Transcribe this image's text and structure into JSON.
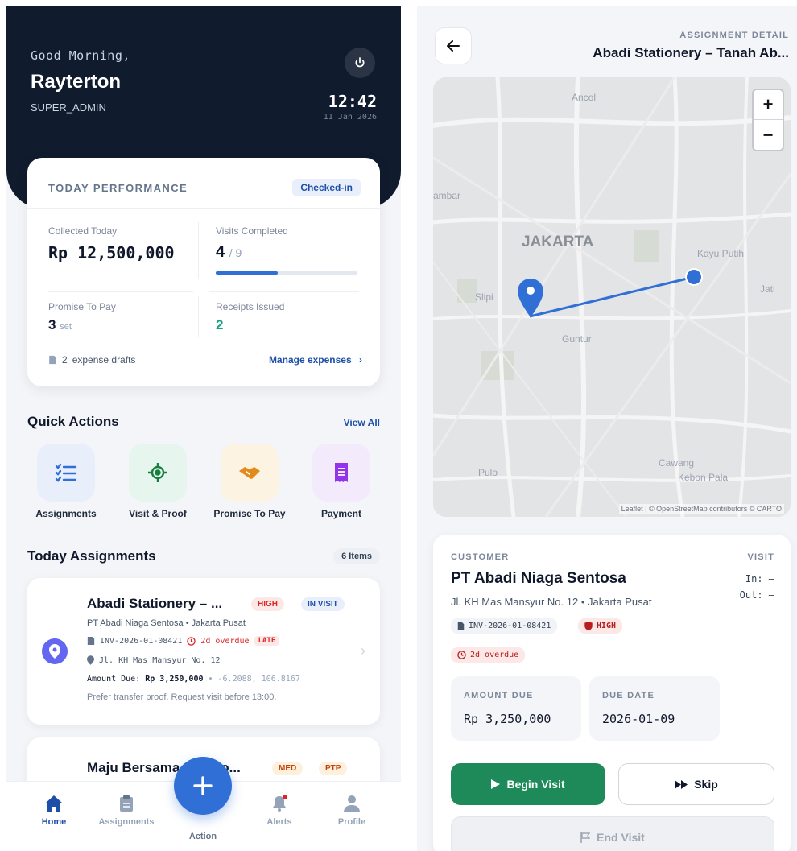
{
  "home": {
    "greeting": "Good Morning,",
    "user_name": "Rayterton",
    "role": "SUPER_ADMIN",
    "time": "12:42",
    "date": "11 Jan 2026",
    "performance": {
      "title": "TODAY PERFORMANCE",
      "status": "Checked-in",
      "collected_label": "Collected Today",
      "collected_value": "Rp 12,500,000",
      "visits_label": "Visits Completed",
      "visits_done": "4",
      "visits_total": "/ 9",
      "visits_progress": 0.44,
      "ptp_label": "Promise To Pay",
      "ptp_value": "3",
      "ptp_unit": "set",
      "receipts_label": "Receipts Issued",
      "receipts_value": "2",
      "drafts_count": "2",
      "drafts_label": "expense drafts",
      "manage_label": "Manage expenses"
    },
    "quick_actions": {
      "title": "Quick Actions",
      "view_all": "View All",
      "items": [
        {
          "label": "Assignments",
          "icon": "list-check-icon"
        },
        {
          "label": "Visit & Proof",
          "icon": "target-icon"
        },
        {
          "label": "Promise To Pay",
          "icon": "handshake-icon"
        },
        {
          "label": "Payment",
          "icon": "receipt-icon"
        }
      ]
    },
    "assignments": {
      "title": "Today Assignments",
      "count": "6 Items",
      "items": [
        {
          "title": "Abadi Stationery – ...",
          "priority": "HIGH",
          "status": "IN VISIT",
          "customer": "PT Abadi Niaga Sentosa • Jakarta Pusat",
          "invoice": "INV-2026-01-08421",
          "overdue": "2d overdue",
          "late": "LATE",
          "address": "Jl. KH Mas Mansyur No. 12",
          "amount_label": "Amount Due:",
          "amount": "Rp 3,250,000",
          "coords": "-6.2088, 106.8167",
          "note": "Prefer transfer proof. Request visit before 13:00."
        },
        {
          "title": "Maju Bersama – Kebo...",
          "priority": "MED",
          "status": "PTP"
        }
      ]
    },
    "nav": [
      {
        "label": "Home",
        "icon": "home-icon",
        "active": true
      },
      {
        "label": "Assignments",
        "icon": "clipboard-icon"
      },
      {
        "label": "Action",
        "icon": "plus-icon"
      },
      {
        "label": "Alerts",
        "icon": "bell-icon"
      },
      {
        "label": "Profile",
        "icon": "user-icon"
      }
    ]
  },
  "detail": {
    "header_label": "ASSIGNMENT DETAIL",
    "header_title": "Abadi Stationery – Tanah Ab...",
    "map": {
      "places": [
        "Ancol",
        "ambar",
        "JAKARTA",
        "Kayu Putih",
        "Slipi",
        "Jati",
        "Guntur",
        "Pulo",
        "Cawang",
        "Kebon Pala"
      ],
      "attribution": "Leaflet | © OpenStreetMap contributors © CARTO",
      "zoom_in": "+",
      "zoom_out": "−"
    },
    "customer_label": "CUSTOMER",
    "customer_name": "PT Abadi Niaga Sentosa",
    "address": "Jl. KH Mas Mansyur No. 12 • Jakarta Pusat",
    "visit_label": "VISIT",
    "visit_in": "In: —",
    "visit_out": "Out: —",
    "invoice": "INV-2026-01-08421",
    "priority": "HIGH",
    "overdue": "2d overdue",
    "amount_label": "AMOUNT DUE",
    "amount": "Rp 3,250,000",
    "due_label": "DUE DATE",
    "due_date": "2026-01-09",
    "begin_label": "Begin Visit",
    "skip_label": "Skip",
    "end_label": "End Visit",
    "colors": {
      "accent": "#2f6fd6",
      "success": "#1e8a5a",
      "danger": "#dc2626"
    }
  }
}
